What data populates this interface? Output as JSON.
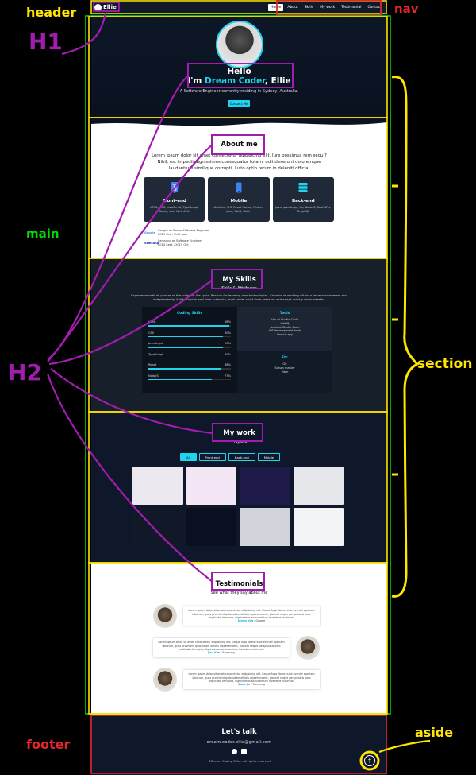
{
  "site": {
    "logo_text": "Ellie",
    "nav": [
      "Home",
      "About",
      "Skills",
      "My work",
      "Testimonial",
      "Contact"
    ],
    "hero": {
      "greeting": "Hello",
      "name_prefix": "I'm ",
      "name_highlight": "Dream Coder",
      "name_suffix": ", Ellie",
      "subtitle": "A Software Engineer currently residing in Sydney, Australia.",
      "cta": "Contact Me"
    },
    "about": {
      "title": "About me",
      "paragraph": "Lorem ipsum dolor sit amet consectetur adipisicing elit. Iure possimus rem sequi? Nihil, est impedit dignissimos consequatur totam, odit deserunt doloremque laudantium similique corrupti, iusto optio rerum in deleniti officia.",
      "cards": [
        {
          "title": "Front-end",
          "desc": "HTML, CSS, JavaScript, TypeScript, React, Vue, Web APIs",
          "icon": "html5-icon"
        },
        {
          "title": "Mobile",
          "desc": "Android, iOS, React Native, Flutter, Java, Swift, Kotlin",
          "icon": "mobile-icon"
        },
        {
          "title": "Back-end",
          "desc": "Java, JavaScript, Go, NodeJS, Rest APIs, GraphQL",
          "icon": "server-icon"
        }
      ],
      "jobs": [
        {
          "logo": "Google",
          "title": "Google as Senior Software Engineer",
          "period": "2019 Oct - Until now"
        },
        {
          "logo": "Samsung",
          "title": "Samsung as Software Engineer",
          "period": "2014 Sept - 2019 Oct"
        }
      ]
    },
    "skills": {
      "title": "My Skills",
      "subtitle": "Skills & Attributes",
      "desc": "Experience with all phases of the software life cycle. Passion for learning new technologies. Capable of working within a team environment and independently. Ability to plan and time schedule, work under strict time pressure and adapt quickly when needed.",
      "coding_title": "Coding Skills",
      "coding": [
        {
          "name": "HTML",
          "pct": 98
        },
        {
          "name": "CSS",
          "pct": 90
        },
        {
          "name": "JavaScript",
          "pct": 90
        },
        {
          "name": "TypeScript",
          "pct": 80
        },
        {
          "name": "React",
          "pct": 88
        },
        {
          "name": "NodeJS",
          "pct": 77
        }
      ],
      "tools_title": "Tools",
      "tools": [
        "Visual Studio Code",
        "IntelliJ",
        "Android Studio Code",
        "iOS development tools",
        "Sketch app"
      ],
      "etc_title": "Etc",
      "etc": [
        "Git",
        "Scrum master",
        "Mom"
      ]
    },
    "work": {
      "title": "My work",
      "subtitle": "Projects",
      "filters": [
        "All",
        "Front-end",
        "Back-end",
        "Mobile"
      ],
      "thumbs": [
        "#ece8f0",
        "#f3e7f6",
        "#1e1b4b",
        "#e5e7eb",
        "#111827",
        "#0b1020",
        "#d1d5db",
        "#f3f4f6"
      ]
    },
    "testimonials": {
      "title": "Testimonials",
      "subtitle": "See what they say about me",
      "items": [
        {
          "text": "Lorem ipsum dolor sit amet consectetur adipisicing elit. Eaque fuga libero nulla eveniet aperiam laborum, quos provident quibusdam officiis reprehenderit, placeat neque perspiciatis vero explicabo tempora, dignissimos accusantium inventore ducimus!",
          "name": "James Kim",
          "company": "Google"
        },
        {
          "text": "Lorem ipsum dolor sit amet consectetur adipisicing elit. Eaque fuga libero nulla eveniet aperiam laborum, quos provident quibusdam officiis reprehenderit, placeat neque perspiciatis vero explicabo tempora, dignissimos accusantium inventore ducimus!",
          "name": "Jisu Kim",
          "company": "Samsung"
        },
        {
          "text": "Lorem ipsum dolor sit amet consectetur adipisicing elit. Eaque fuga libero nulla eveniet aperiam laborum, quos provident quibusdam officiis reprehenderit, placeat neque perspiciatis vero explicabo tempora, dignissimos accusantium inventore ducimus!",
          "name": "Anna Jin",
          "company": "Samsung"
        }
      ]
    },
    "footer": {
      "title": "Let's talk",
      "email": "dream.coder.ellie@gmail.com",
      "copyright": "©Dream Coding Ellie - All rights reserved"
    }
  },
  "annotations": {
    "header": "header",
    "nav": "nav",
    "h1": "H1",
    "main": "main",
    "h2": "H2",
    "section": "section",
    "footer": "footer",
    "aside": "aside"
  },
  "colors": {
    "annotation_yellow": "#ffe500",
    "annotation_red": "#e3262c",
    "annotation_magenta": "#a21caf",
    "annotation_green": "#00e000",
    "accent": "#22d3ee"
  }
}
